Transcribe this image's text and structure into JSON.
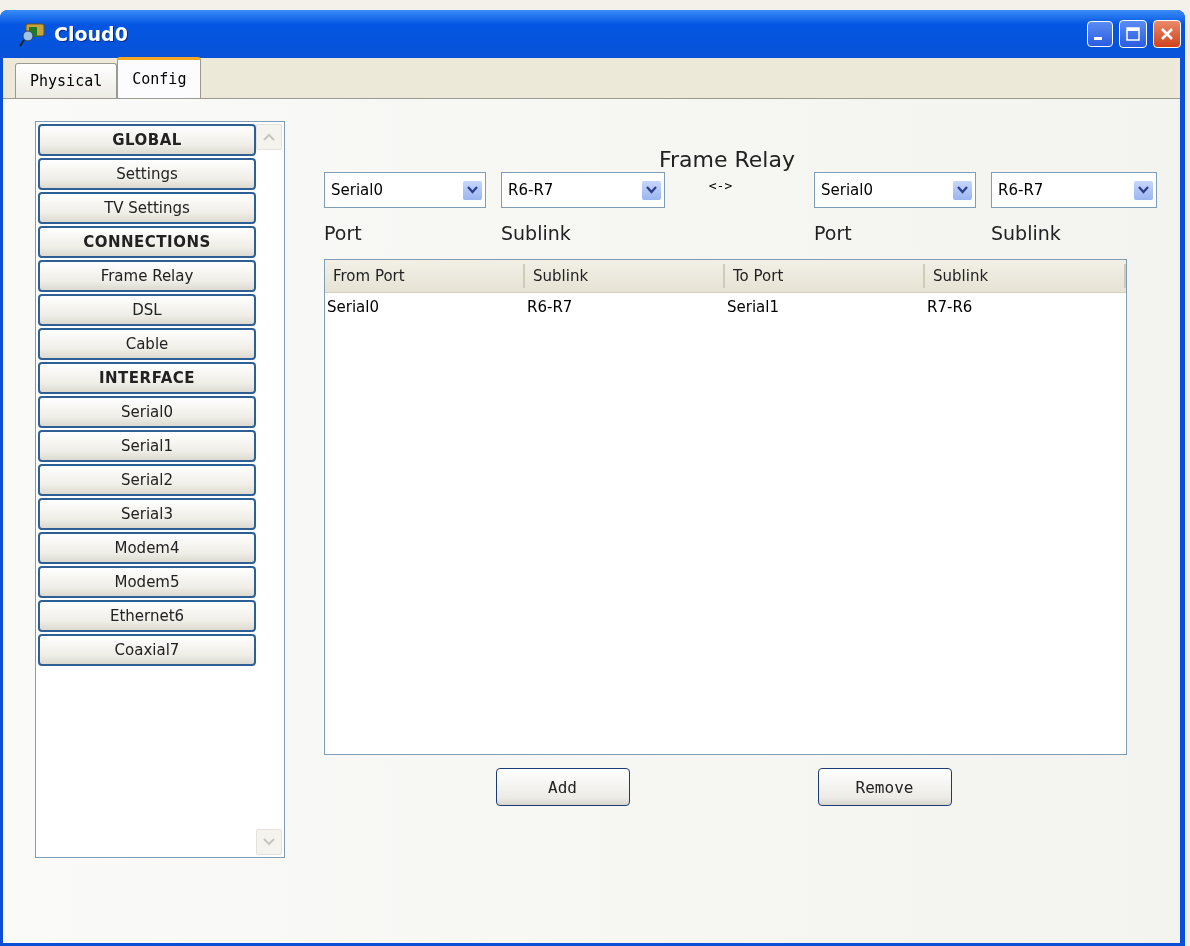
{
  "window": {
    "title": "Cloud0"
  },
  "tabs": [
    {
      "label": "Physical",
      "selected": false
    },
    {
      "label": "Config",
      "selected": true
    }
  ],
  "sidebar": {
    "items": [
      {
        "label": "GLOBAL",
        "kind": "header"
      },
      {
        "label": "Settings",
        "kind": "item"
      },
      {
        "label": "TV Settings",
        "kind": "item"
      },
      {
        "label": "CONNECTIONS",
        "kind": "header"
      },
      {
        "label": "Frame Relay",
        "kind": "item"
      },
      {
        "label": "DSL",
        "kind": "item"
      },
      {
        "label": "Cable",
        "kind": "item"
      },
      {
        "label": "INTERFACE",
        "kind": "header"
      },
      {
        "label": "Serial0",
        "kind": "item"
      },
      {
        "label": "Serial1",
        "kind": "item"
      },
      {
        "label": "Serial2",
        "kind": "item"
      },
      {
        "label": "Serial3",
        "kind": "item"
      },
      {
        "label": "Modem4",
        "kind": "item"
      },
      {
        "label": "Modem5",
        "kind": "item"
      },
      {
        "label": "Ethernet6",
        "kind": "item"
      },
      {
        "label": "Coaxial7",
        "kind": "item"
      }
    ]
  },
  "panel": {
    "title": "Frame Relay",
    "selectors": [
      {
        "value": "Serial0",
        "caption": "Port"
      },
      {
        "value": "R6-R7",
        "caption": "Sublink"
      },
      {
        "value": "Serial0",
        "caption": "Port"
      },
      {
        "value": "R6-R7",
        "caption": "Sublink"
      }
    ],
    "link_symbol": "<->",
    "table": {
      "columns": [
        "From Port",
        "Sublink",
        "To Port",
        "Sublink"
      ],
      "rows": [
        [
          "Serial0",
          "R6-R7",
          "Serial1",
          "R7-R6"
        ]
      ]
    },
    "buttons": [
      "Add",
      "Remove"
    ]
  }
}
